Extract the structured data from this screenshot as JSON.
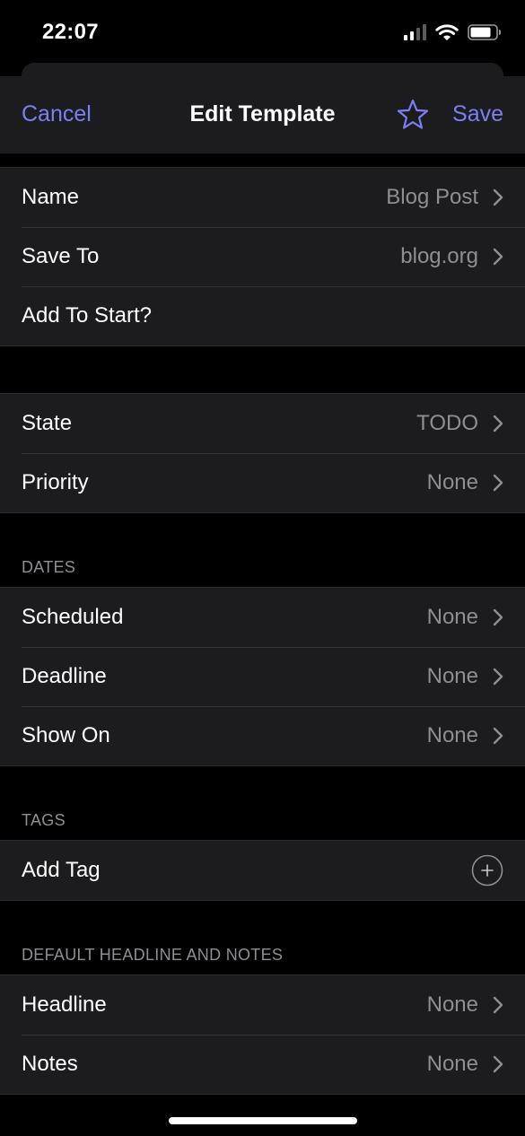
{
  "status_bar": {
    "time": "22:07",
    "icons": [
      "cellular-signal-icon",
      "wifi-icon",
      "battery-icon"
    ]
  },
  "nav": {
    "cancel_label": "Cancel",
    "title": "Edit Template",
    "favorite_icon": "star-icon",
    "save_label": "Save"
  },
  "colors": {
    "accent": "#7c7ef5",
    "background": "#000000",
    "cell": "#1c1c1e",
    "secondary_text": "#8e8e93"
  },
  "general": {
    "name": {
      "label": "Name",
      "value": "Blog Post"
    },
    "save_to": {
      "label": "Save To",
      "value": "blog.org"
    },
    "add_to_start": {
      "label": "Add To Start?"
    }
  },
  "task": {
    "state": {
      "label": "State",
      "value": "TODO"
    },
    "priority": {
      "label": "Priority",
      "value": "None"
    }
  },
  "dates": {
    "header": "DATES",
    "scheduled": {
      "label": "Scheduled",
      "value": "None"
    },
    "deadline": {
      "label": "Deadline",
      "value": "None"
    },
    "show_on": {
      "label": "Show On",
      "value": "None"
    }
  },
  "tags": {
    "header": "TAGS",
    "add_tag": {
      "label": "Add Tag"
    }
  },
  "defaults": {
    "header": "DEFAULT HEADLINE AND NOTES",
    "headline": {
      "label": "Headline",
      "value": "None"
    },
    "notes": {
      "label": "Notes",
      "value": "None"
    }
  }
}
